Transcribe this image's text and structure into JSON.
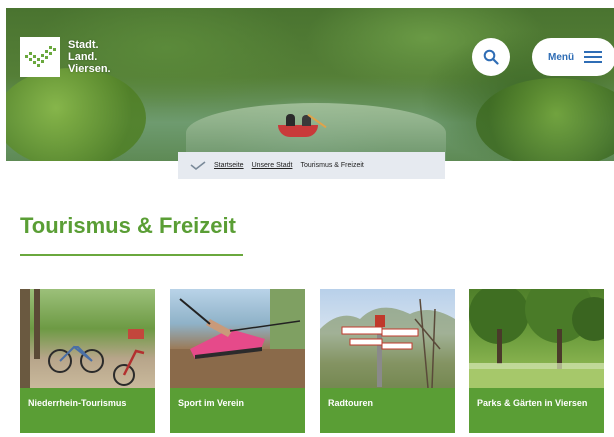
{
  "header": {
    "logo_lines": [
      "Stadt.",
      "Land.",
      "Viersen."
    ],
    "menu_label": "Menü"
  },
  "breadcrumb": {
    "items": [
      "Startseite",
      "Unsere Stadt",
      "Tourismus & Freizeit"
    ]
  },
  "main": {
    "title": "Tourismus & Freizeit",
    "cards": [
      {
        "label": "Niederrhein-Tourismus"
      },
      {
        "label": "Sport im Verein"
      },
      {
        "label": "Radtouren"
      },
      {
        "label": "Parks & Gärten in Viersen"
      }
    ]
  },
  "colors": {
    "brand_green": "#5a9e35",
    "link_blue": "#2f6db5",
    "breadcrumb_bg": "#e6eaf0"
  },
  "icons": {
    "search": "search-icon",
    "menu": "hamburger-menu-icon",
    "breadcrumb_home": "checkmark-logo-icon"
  }
}
